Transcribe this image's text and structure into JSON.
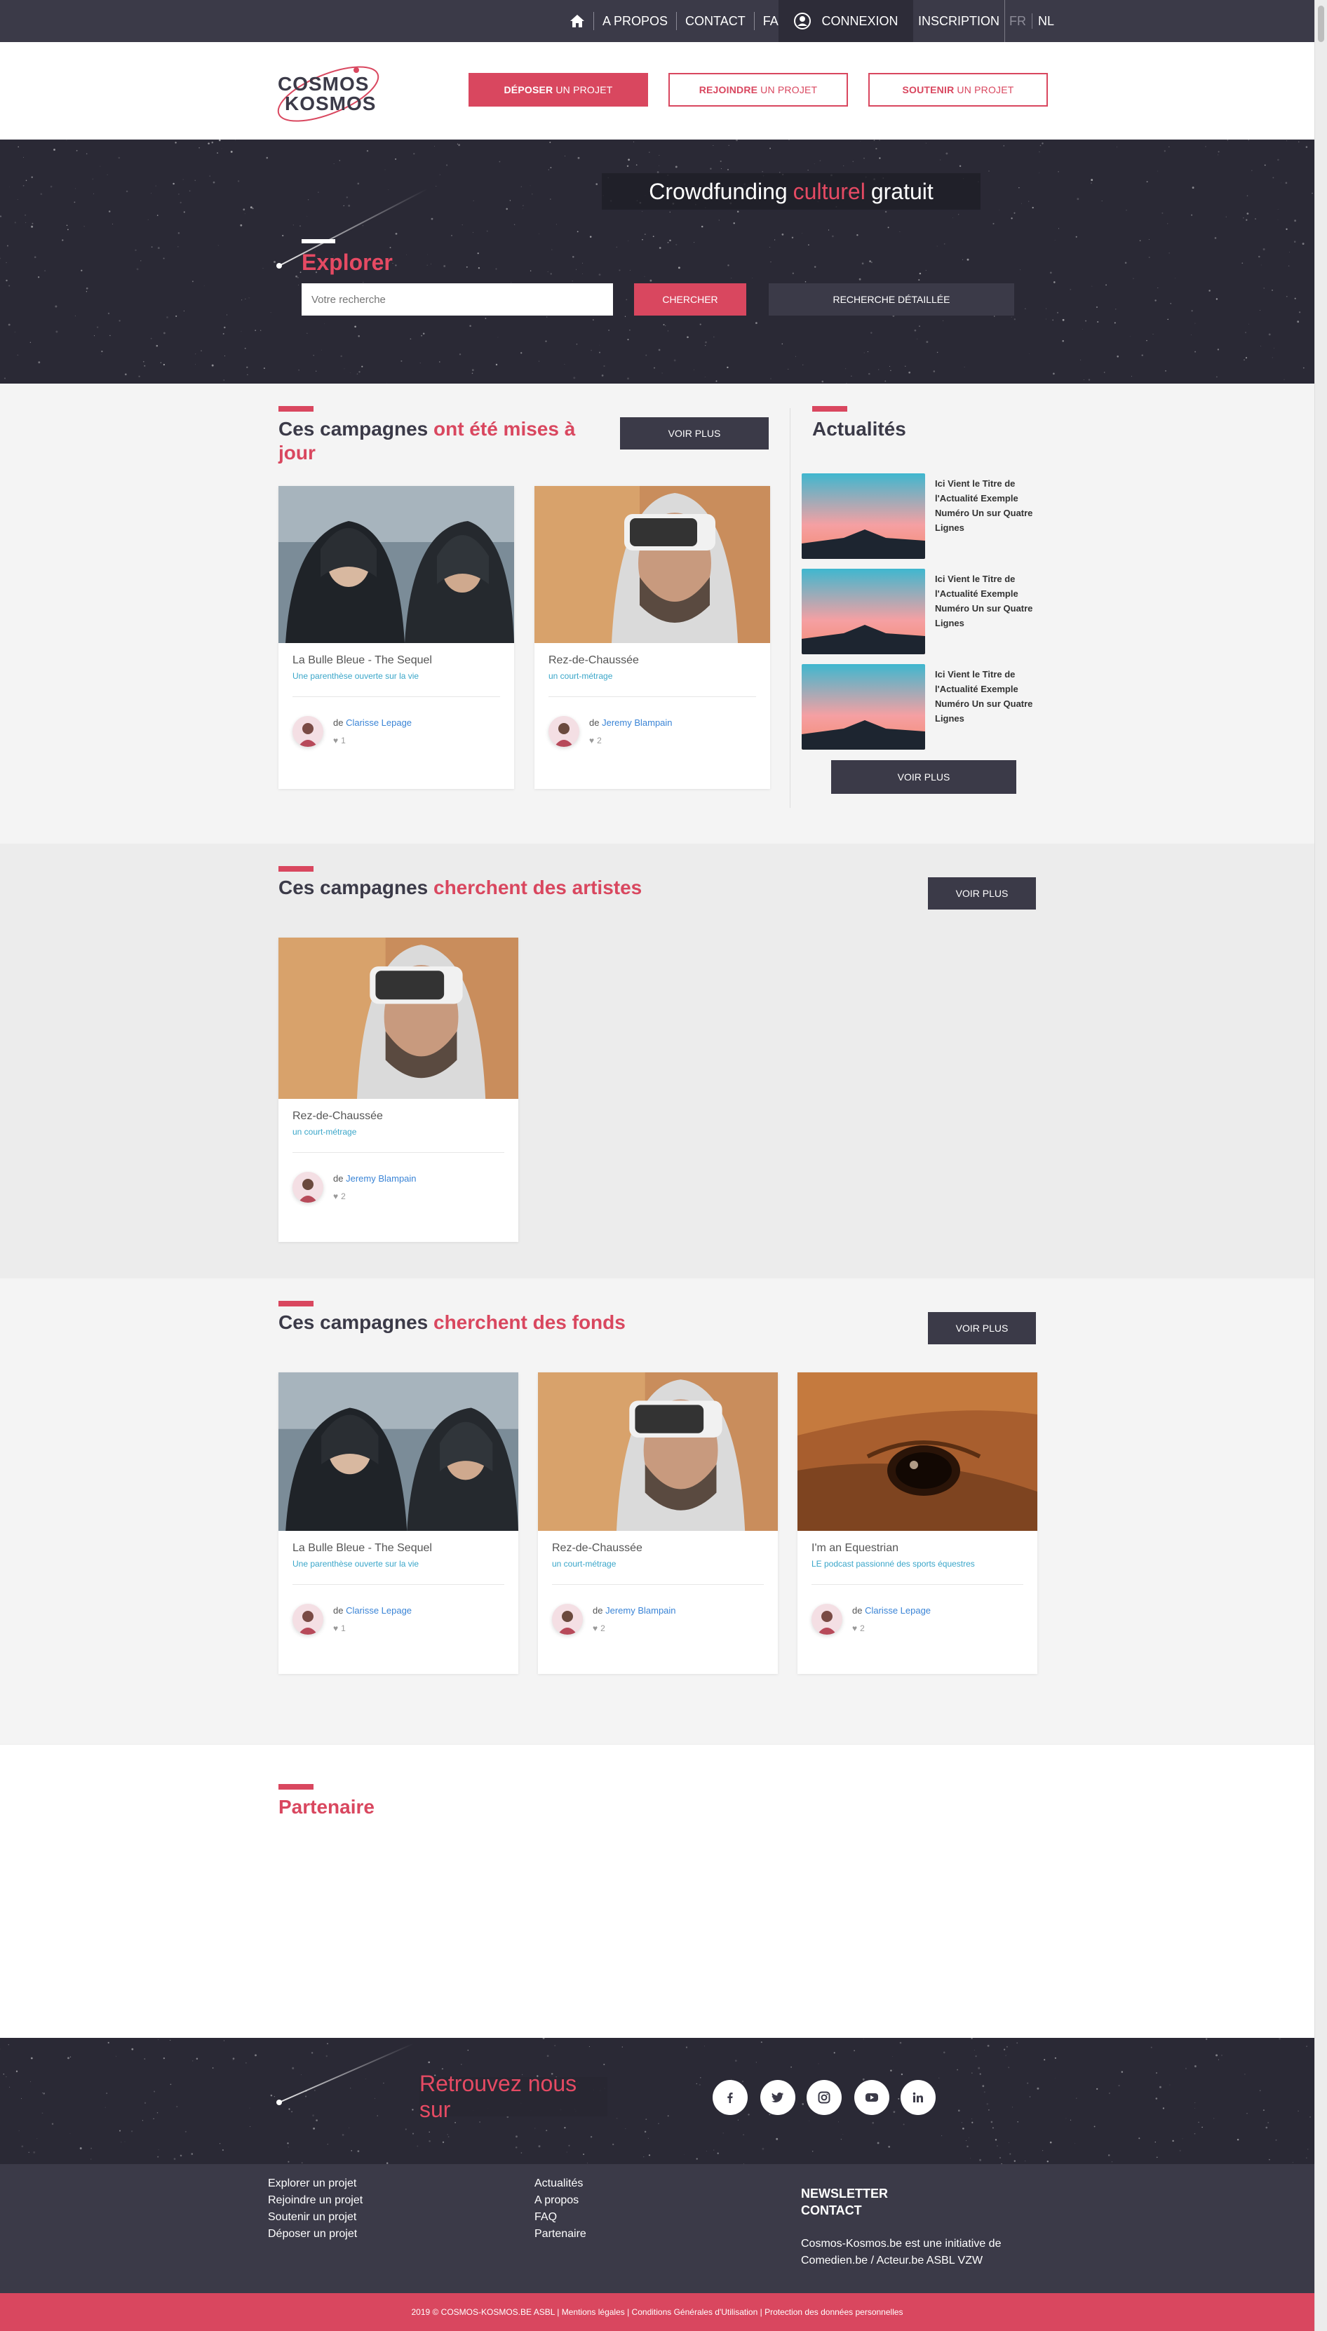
{
  "topbar": {
    "nav": [
      "A PROPOS",
      "CONTACT",
      "FAQ"
    ],
    "login": "CONNEXION",
    "register": "INSCRIPTION",
    "lang_fr": "FR",
    "lang_nl": "NL"
  },
  "header": {
    "logo_line1": "COSMOS",
    "logo_line2": "KOSMOS",
    "btn1_bold": "DÉPOSER",
    "btn1_rest": "UN PROJET",
    "btn2_bold": "REJOINDRE",
    "btn2_rest": "UN PROJET",
    "btn3_bold": "SOUTENIR",
    "btn3_rest": "UN PROJET"
  },
  "hero": {
    "title_a": "Crowdfunding",
    "title_hl": "culturel",
    "title_b": "gratuit",
    "explore": "Explorer",
    "search_placeholder": "Votre recherche",
    "search_btn": "CHERCHER",
    "advanced_btn": "RECHERCHE DÉTAILLÉE"
  },
  "updated": {
    "title_a": "Ces campagnes",
    "title_hl": "ont été mises à jour",
    "more": "VOIR PLUS",
    "cards": [
      {
        "title": "La Bulle Bleue - The Sequel",
        "sub": "Une parenthèse ouverte sur la vie",
        "by": "de",
        "author": "Clarisse Lepage",
        "likes": "1"
      },
      {
        "title": "Rez-de-Chaussée",
        "sub": "un court-métrage",
        "by": "de",
        "author": "Jeremy Blampain",
        "likes": "2"
      }
    ]
  },
  "news": {
    "title": "Actualités",
    "items": [
      "Ici Vient le Titre de l'Actualité Exemple Numéro Un sur Quatre Lignes",
      "Ici Vient le Titre de l'Actualité Exemple Numéro Un sur Quatre Lignes",
      "Ici Vient le Titre de l'Actualité Exemple Numéro Un sur Quatre Lignes"
    ],
    "more": "VOIR PLUS"
  },
  "artists": {
    "title_a": "Ces campagnes",
    "title_hl": "cherchent des artistes",
    "more": "VOIR PLUS",
    "cards": [
      {
        "title": "Rez-de-Chaussée",
        "sub": "un court-métrage",
        "by": "de",
        "author": "Jeremy Blampain",
        "likes": "2"
      }
    ]
  },
  "funds": {
    "title_a": "Ces campagnes",
    "title_hl": "cherchent des fonds",
    "more": "VOIR PLUS",
    "cards": [
      {
        "title": "La Bulle Bleue - The Sequel",
        "sub": "Une parenthèse ouverte sur la vie",
        "by": "de",
        "author": "Clarisse Lepage",
        "likes": "1"
      },
      {
        "title": "Rez-de-Chaussée",
        "sub": "un court-métrage",
        "by": "de",
        "author": "Jeremy Blampain",
        "likes": "2"
      },
      {
        "title": "I'm an Equestrian",
        "sub": "LE podcast passionné des sports équestres",
        "by": "de",
        "author": "Clarisse Lepage",
        "likes": "2"
      }
    ]
  },
  "partner": {
    "title": "Partenaire"
  },
  "footer": {
    "find_us": "Retrouvez nous sur",
    "col1": [
      "Explorer un projet",
      "Rejoindre un projet",
      "Soutenir un projet",
      "Déposer un projet"
    ],
    "col2": [
      "Actualités",
      "A propos",
      "FAQ",
      "Partenaire"
    ],
    "newsletter": "NEWSLETTER",
    "contact": "CONTACT",
    "info": "Cosmos-Kosmos.be est une initiative de Comedien.be / Acteur.be ASBL VZW",
    "bottom": "2019 © COSMOS-KOSMOS.BE ASBL | Mentions légales | Conditions Générales d'Utilisation | Protection des données personnelles"
  },
  "colors": {
    "accent": "#d9475f",
    "dark": "#3b3a48",
    "link": "#3a84d6",
    "sub": "#3aa6c9"
  }
}
